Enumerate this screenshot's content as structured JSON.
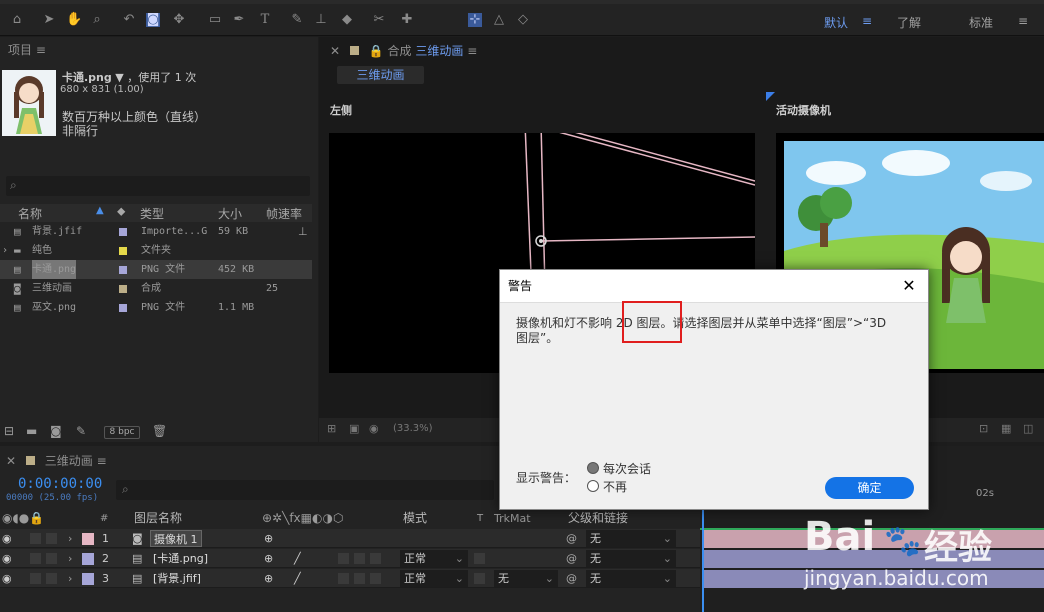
{
  "workspaces": [
    "默认",
    "了解",
    "标准"
  ],
  "project": {
    "panel_title": "项目",
    "selected_name": "卡通.png",
    "selected_usage": "，使用了 1 次",
    "selected_dims": "680 x 831 (1.00)",
    "selected_color": "数百万种以上颜色（直线）",
    "selected_interlace": "非隔行",
    "columns": {
      "name": "名称",
      "type": "类型",
      "size": "大小",
      "fps": "帧速率"
    },
    "items": [
      {
        "name": "背景.jfif",
        "type": "Importe...G",
        "size": "59 KB",
        "fps": "",
        "color": "#a6a6d8"
      },
      {
        "name": "纯色",
        "type": "文件夹",
        "size": "",
        "fps": "",
        "color": "#e5d94a"
      },
      {
        "name": "卡通.png",
        "type": "PNG 文件",
        "size": "452 KB",
        "fps": "",
        "color": "#a6a6d8"
      },
      {
        "name": "三维动画",
        "type": "合成",
        "size": "",
        "fps": "25",
        "color": "#bcae88"
      },
      {
        "name": "巫文.png",
        "type": "PNG 文件",
        "size": "1.1 MB",
        "fps": "",
        "color": "#a6a6d8"
      }
    ],
    "bpc": "8 bpc"
  },
  "comp": {
    "panel_prefix": "合成",
    "panel_name": "三维动画",
    "tab": "三维动画",
    "view_left": "左侧",
    "view_camera": "活动摄像机",
    "zoom": "(33.3%)"
  },
  "timeline": {
    "tab": "三维动画",
    "timecode": "0:00:00:00",
    "frames": "00000 (25.00 fps)",
    "columns": {
      "num": "#",
      "layer_name": "图层名称",
      "mode": "模式",
      "t": "T",
      "trkmat": "TrkMat",
      "parent": "父级和链接"
    },
    "ruler": "02s",
    "layers": [
      {
        "num": "1",
        "name": "摄像机 1",
        "mode": "",
        "trkmat": "",
        "parent": "无",
        "color": "#e6b7c4"
      },
      {
        "num": "2",
        "name": "[卡通.png]",
        "mode": "正常",
        "trkmat": "",
        "parent": "无",
        "color": "#a6a6d8"
      },
      {
        "num": "3",
        "name": "[背景.jfif]",
        "mode": "正常",
        "trkmat": "无",
        "parent": "无",
        "color": "#a6a6d8"
      }
    ]
  },
  "dialog": {
    "title": "警告",
    "message_1": "摄像机和灯不影响 2D 图层。请选择图层并从菜单中选择“图层”>“3D",
    "message_2": "图层”。",
    "show_label": "显示警告：",
    "option_each": "每次会话",
    "option_never": "不再",
    "ok_label": "确定"
  },
  "watermark": {
    "brand": "Bai",
    "brand2": "经验",
    "url": "jingyan.baidu.com"
  }
}
